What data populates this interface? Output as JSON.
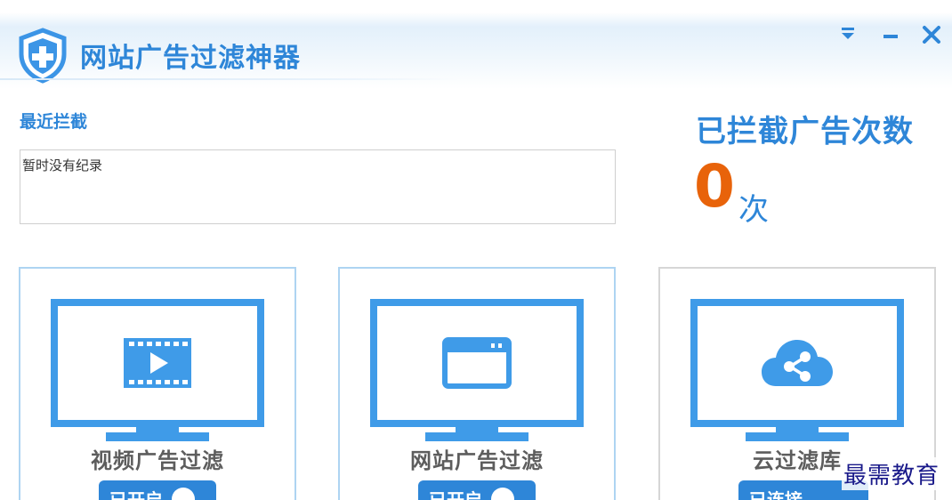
{
  "app": {
    "title": "网站广告过滤神器"
  },
  "window_controls": {
    "menu_icon": "dropdown-menu-icon",
    "minimize_icon": "minimize-icon",
    "close_icon": "close-icon"
  },
  "recent": {
    "title": "最近拦截",
    "empty_text": "暂时没有纪录"
  },
  "stats": {
    "title": "已拦截广告次数",
    "count": "0",
    "unit": "次"
  },
  "cards": [
    {
      "label": "视频广告过滤",
      "icon": "video-play-icon",
      "status": "已开启"
    },
    {
      "label": "网站广告过滤",
      "icon": "browser-window-icon",
      "status": "已开启"
    },
    {
      "label": "云过滤库",
      "icon": "cloud-share-icon",
      "status": "已连接"
    }
  ],
  "watermark": "最需教育",
  "colors": {
    "accent": "#2e86d8",
    "count": "#e8630a",
    "icon_blue": "#3f9be8"
  }
}
